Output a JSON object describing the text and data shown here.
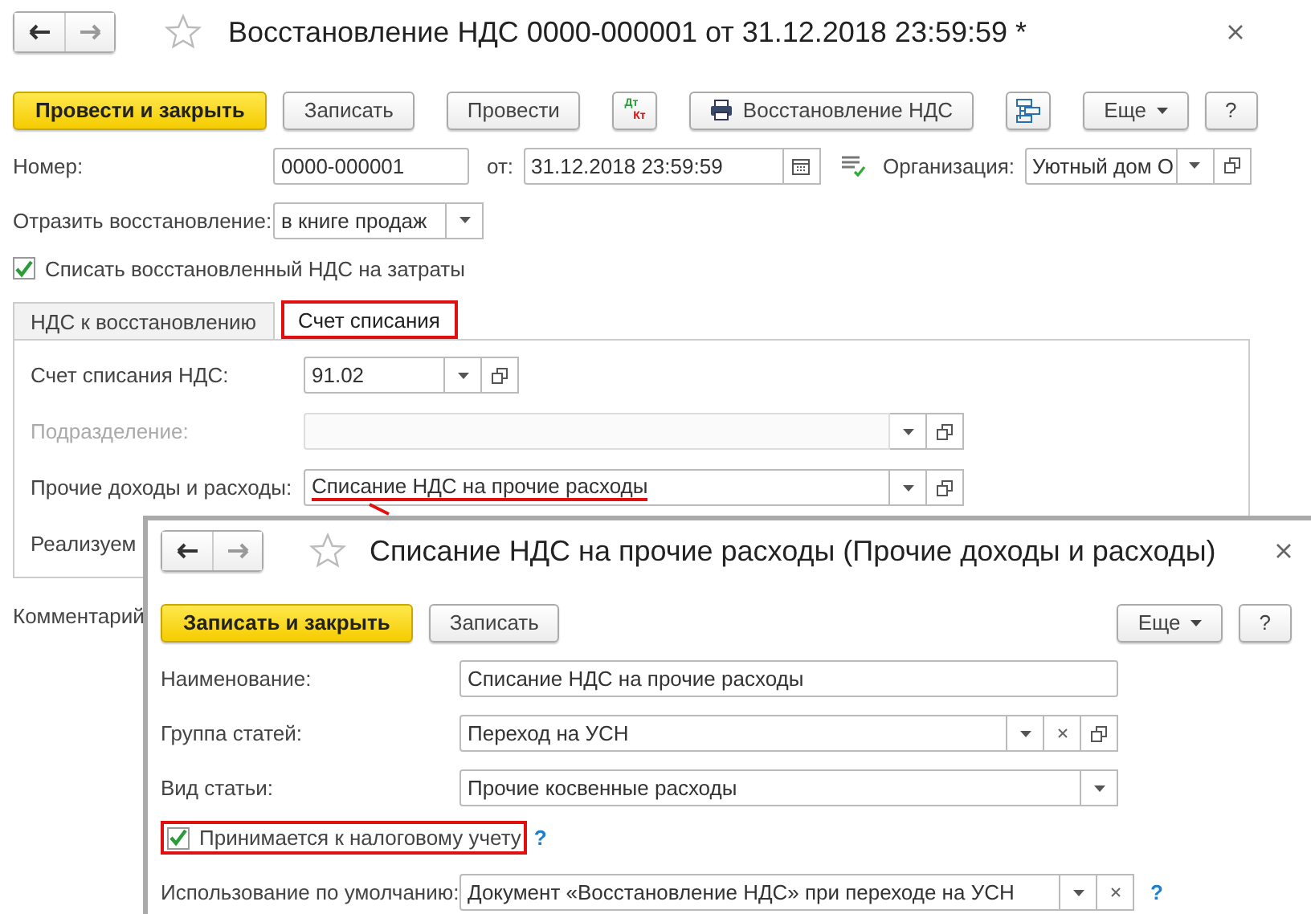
{
  "window": {
    "title": "Восстановление НДС 0000-000001 от 31.12.2018 23:59:59 *"
  },
  "toolbar": [
    {
      "kind": "primary",
      "label": "Провести и закрыть"
    },
    {
      "kind": "button",
      "label": "Записать"
    },
    {
      "kind": "button",
      "label": "Провести"
    },
    {
      "kind": "dtkt",
      "top": "Дт",
      "bottom": "Кт"
    },
    {
      "kind": "print",
      "label": "Восстановление НДС"
    },
    {
      "kind": "structure"
    },
    {
      "kind": "menu",
      "label": "Еще"
    },
    {
      "kind": "button",
      "label": "?"
    }
  ],
  "number": {
    "label": "Номер:",
    "value": "0000-000001"
  },
  "date": {
    "label": "от:",
    "value": "31.12.2018 23:59:59"
  },
  "organization": {
    "label": "Организация:",
    "value": "Уютный дом О"
  },
  "reflect": {
    "label": "Отразить восстановление:",
    "value": "в книге продаж"
  },
  "writeoff": {
    "label": "Списать восстановленный НДС на затраты",
    "checked": true
  },
  "tabs": [
    {
      "label": "НДС к восстановлению",
      "selected": false,
      "highlighted": false
    },
    {
      "label": "Счет списания",
      "selected": true,
      "highlighted": true
    }
  ],
  "account_fields": [
    {
      "kind": "short",
      "label": "Счет списания НДС:",
      "value": "91.02",
      "disabled": false,
      "highlighted": false
    },
    {
      "kind": "wide",
      "label": "Подразделение:",
      "disabled": true,
      "highlighted": false
    },
    {
      "kind": "wide",
      "label": "Прочие доходы и расходы:",
      "value": "Списание НДС на прочие расходы",
      "disabled": false,
      "highlighted": true
    },
    {
      "kind": "plain",
      "label": "Реализуем"
    }
  ],
  "comment": {
    "label": "Комментарий"
  },
  "dialog": {
    "title": "Списание НДС на прочие расходы (Прочие доходы и расходы)",
    "toolbar": [
      {
        "kind": "primary",
        "label": "Записать и закрыть"
      },
      {
        "kind": "button",
        "label": "Записать"
      },
      {
        "kind": "menu",
        "label": "Еще"
      },
      {
        "kind": "button",
        "label": "?"
      }
    ],
    "fields": [
      {
        "label": "Наименование:",
        "value": "Списание НДС на прочие расходы"
      },
      {
        "label": "Группа статей:",
        "value": "Переход на УСН",
        "dropdown": true,
        "clear": true,
        "open": true
      },
      {
        "label": "Вид статьи:",
        "value": "Прочие косвенные расходы",
        "dropdown": true
      }
    ],
    "checkbox": {
      "label": "Принимается к налоговому учету",
      "checked": true,
      "highlighted": true,
      "help": "?"
    },
    "default": {
      "label": "Использование по умолчанию:",
      "value": "Документ «Восстановление НДС» при переходе на УСН",
      "dropdown": true,
      "clear": true,
      "help": "?"
    }
  }
}
